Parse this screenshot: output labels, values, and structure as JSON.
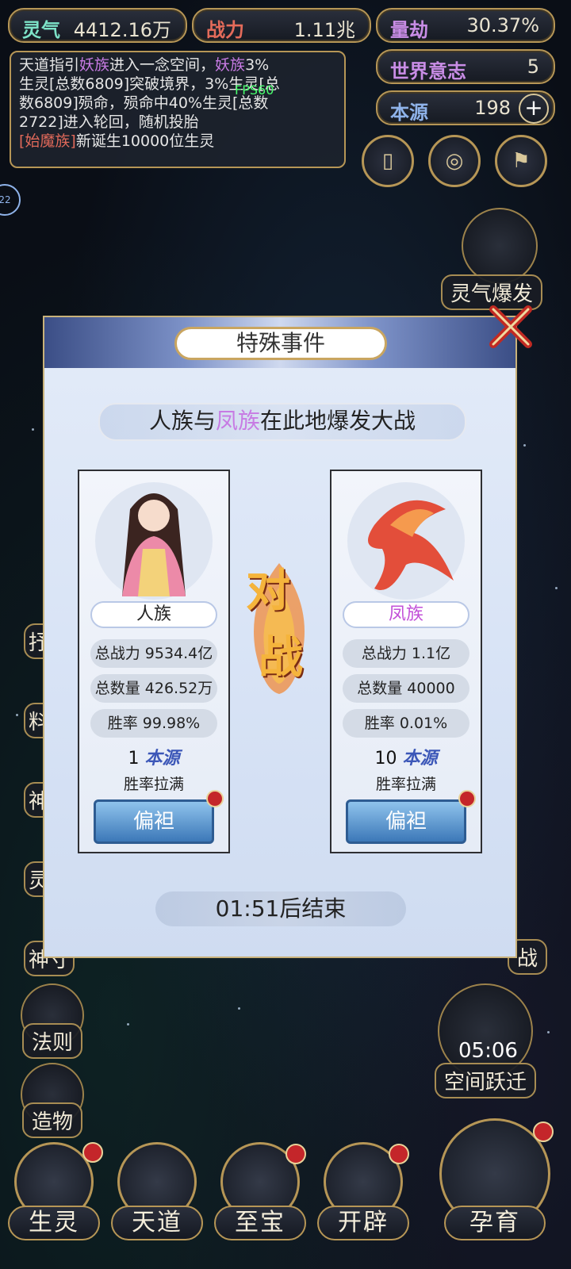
{
  "topbar": {
    "lingqi": {
      "label": "灵气",
      "value": "4412.16万"
    },
    "zhanli": {
      "label": "战力",
      "value": "1.11兆"
    },
    "liangjie": {
      "label": "量劫",
      "value": "30.37%"
    },
    "shijie": {
      "label": "世界意志",
      "value": "5"
    },
    "benyuan": {
      "label": "本源",
      "value": "198"
    }
  },
  "log": {
    "line1": "天道指引",
    "line1_purple": "妖族",
    "line1b": "进入一念空间，",
    "line1_purple2": "妖族",
    "line1c": "3%",
    "line2": "生灵[总数6809]突破境界，3%生灵[总",
    "line3": "数6809]殒命，殒命中40%生灵[总数",
    "line4": "2722]进入轮回，随机投胎",
    "line5_red": "[始魔族]",
    "line5": "新诞生10000位生灵"
  },
  "fps": "FPS60",
  "side_left_badge": "22",
  "right_buttons": {
    "lingqi_baofa": "灵气爆发",
    "kongjian_yueqian": "空间跃迁",
    "kongjian_timer": "05:06",
    "partial_label": "战"
  },
  "left_menu": {
    "fa_ze": "法则",
    "zao_wu": "造物",
    "partial1": "抒",
    "partial2": "料",
    "partial3": "神",
    "partial4": "灵",
    "partial5": "神寸"
  },
  "bottom_nav": [
    {
      "label": "生灵"
    },
    {
      "label": "天道"
    },
    {
      "label": "至宝"
    },
    {
      "label": "开辟"
    },
    {
      "label": "孕育"
    }
  ],
  "modal": {
    "title": "特殊事件",
    "subtitle_a": "人族与",
    "subtitle_b": "凤族",
    "subtitle_c": "在此地爆发大战",
    "vs_top": "对",
    "vs_bottom": "战",
    "left": {
      "name": "人族",
      "power": "总战力 9534.4亿",
      "count": "总数量 426.52万",
      "winrate": "胜率 99.98%",
      "cost_num": "1",
      "cost_unit": "本源",
      "max_note": "胜率拉满",
      "favor": "偏袒"
    },
    "right": {
      "name": "凤族",
      "power": "总战力 1.1亿",
      "count": "总数量 40000",
      "winrate": "胜率 0.01%",
      "cost_num": "10",
      "cost_unit": "本源",
      "max_note": "胜率拉满",
      "favor": "偏袒"
    },
    "timer": "01:51后结束"
  },
  "colors": {
    "gold": "#b69656",
    "purple": "#c77be3",
    "red": "#e0695a",
    "button_blue": "#3c78b8"
  }
}
